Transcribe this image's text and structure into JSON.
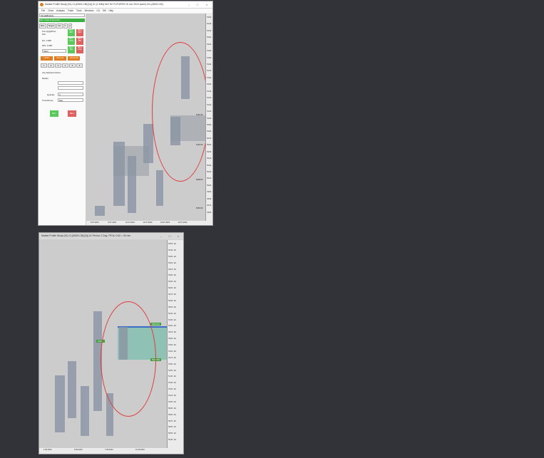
{
  "desktop": {
    "background": "#313338"
  },
  "window_top": {
    "title": "Market Profile Study (51) CL(ZM24.CB(Q4)) #1 (2 MIN) NLF.S0 FUTURES 15 Jun 2024 (ssmi) ZCL(ZM24.CB)",
    "menu": [
      "File",
      "Chart",
      "Analysis",
      "Trade",
      "Tools",
      "Windows",
      "CA",
      "Stif",
      "Help"
    ],
    "order_panel": {
      "account_type": "SimpleBracket",
      "status": "SIM 1 Trade ID Execution",
      "tabs": [
        "Main",
        "Targets",
        "Sec",
        "C",
        "A"
      ],
      "pos_label": "Pos Qty@Price:",
      "pos_value": "Flat",
      "pl_label": "P/L: 0.00P",
      "dpl_label": "DPL: 0.00P",
      "order_type": "Short",
      "buy_mkt": "BUY MKT",
      "sell_mkt": "SELL MKT",
      "buy_ask": "BUY ASK",
      "sell_bid": "SELL BID",
      "buy_bid": "BUY BID",
      "sell_ask": "SELL ASK",
      "flatten": "Flatten",
      "reverse": "Reverse",
      "cancel_all": "Cancel All",
      "qty_buttons": [
        "1",
        "2",
        "3",
        "4",
        "5",
        "6"
      ],
      "use_attached": "Use Attached Orders",
      "market_label": "Market",
      "quantity_label": "Quantity",
      "quantity_value": "4",
      "tif_label": "TimeInForce",
      "tif_value": "Day",
      "buy": "BUY",
      "sell": "SELL"
    },
    "price_ticks": [
      "5250.00",
      "5240.00",
      "5230.00",
      "5220.00",
      "5210.00",
      "5200.00",
      "5190.00",
      "5180.00",
      "5170.00",
      "5160.00",
      "5150.00",
      "5140.00",
      "5130.00",
      "5120.00",
      "5110.00",
      "5100.00",
      "5090.00",
      "5080.00",
      "5070.00",
      "5060.00",
      "5050.00",
      "5040.00",
      "5030.00",
      "5020.00",
      "5010.00",
      "5000.00",
      "4990.00",
      "4980.00",
      "4970.00",
      "4960.00"
    ],
    "level_labels": [
      "5160.25",
      "5125.50",
      "5098.00",
      "5050.50"
    ],
    "time_labels": [
      "6.07.2024",
      "9.07.2024",
      "11.07.2024",
      "14.07.2024",
      "16.07.2024",
      "19.07.2024"
    ]
  },
  "window_bottom": {
    "title": "Market Profile Study (51) CL(ZM24.CB(Q4)) #1 Period: 1 Day, TPOs: 0.00 = 30 min",
    "va_label": "CVA1",
    "va_high": "5284.50",
    "va_low": "5220.50",
    "price_ticks": [
      "5355.00",
      "5345.00",
      "5335.00",
      "5325.00",
      "5315.00",
      "5305.00",
      "5295.00",
      "5285.00",
      "5275.00",
      "5265.00",
      "5255.00",
      "5245.00",
      "5235.00",
      "5225.00",
      "5215.00",
      "5205.00",
      "5195.00",
      "5185.00",
      "5175.00",
      "5165.00",
      "5155.00",
      "5145.00",
      "5135.00",
      "5125.00",
      "5115.00",
      "5105.00",
      "5095.00",
      "5085.00",
      "5075.00",
      "5065.00",
      "5055.00",
      "5045.00"
    ],
    "time_labels": [
      "1.06.2024",
      "5.06.2024",
      "7.06.2024",
      "11.06.2024"
    ]
  }
}
